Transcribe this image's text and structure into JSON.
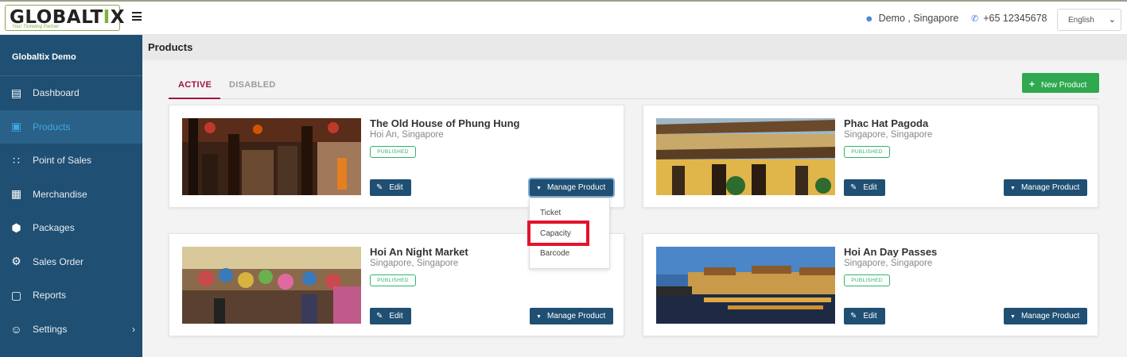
{
  "header": {
    "logo": "GLOBALTIX",
    "logo_tagline": "Your Ticketing Partner",
    "user": "Demo , Singapore",
    "phone": "+65 12345678",
    "language": "English"
  },
  "sidebar": {
    "title": "Globaltix Demo",
    "items": [
      {
        "label": "Dashboard",
        "icon": "bar-chart-icon"
      },
      {
        "label": "Products",
        "icon": "ticket-icon",
        "active": true
      },
      {
        "label": "Point of Sales",
        "icon": "grid-icon"
      },
      {
        "label": "Merchandise",
        "icon": "cart-icon"
      },
      {
        "label": "Packages",
        "icon": "box-icon"
      },
      {
        "label": "Sales Order",
        "icon": "gear-icon"
      },
      {
        "label": "Reports",
        "icon": "document-icon"
      },
      {
        "label": "Settings",
        "icon": "user-gear-icon"
      }
    ]
  },
  "page": {
    "title": "Products",
    "tabs": [
      "ACTIVE",
      "DISABLED"
    ],
    "new_button": "New Product"
  },
  "products": [
    {
      "title": "The Old House of Phung Hung",
      "location": "Hoi An, Singapore",
      "status": "PUBLISHED",
      "edit": "Edit",
      "manage": "Manage Product"
    },
    {
      "title": "Phac Hat Pagoda",
      "location": "Singapore, Singapore",
      "status": "PUBLISHED",
      "edit": "Edit",
      "manage": "Manage Product"
    },
    {
      "title": "Hoi An Night Market",
      "location": "Singapore, Singapore",
      "status": "PUBLISHED",
      "edit": "Edit",
      "manage": "Manage Product"
    },
    {
      "title": "Hoi An Day Passes",
      "location": "Singapore, Singapore",
      "status": "PUBLISHED",
      "edit": "Edit",
      "manage": "Manage Product"
    }
  ],
  "dropdown": {
    "items": [
      "Ticket",
      "Capacity",
      "Barcode"
    ],
    "highlighted": "Capacity"
  },
  "colors": {
    "sidebar": "#1f4f72",
    "accent": "#a01147",
    "success": "#2fa84f",
    "highlight": "#e3132c"
  }
}
